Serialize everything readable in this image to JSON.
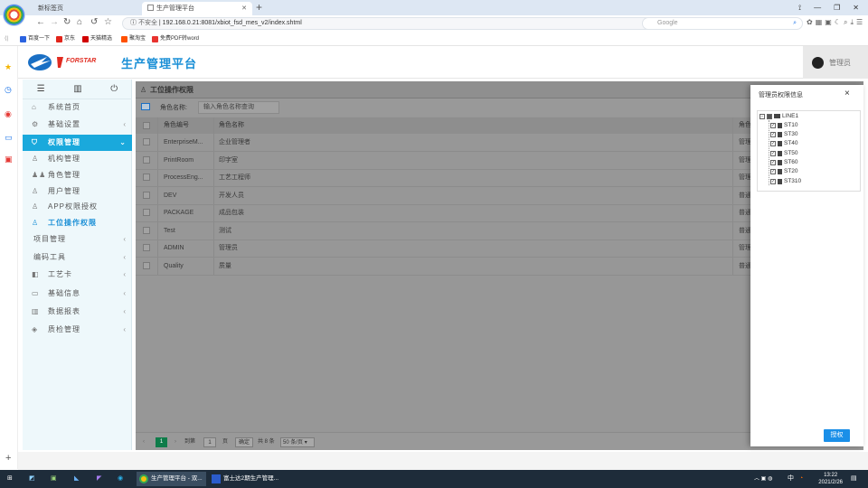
{
  "browser": {
    "tabs": [
      {
        "label": "新标签页"
      },
      {
        "label": "生产管理平台"
      }
    ],
    "new_tab": "+",
    "window_controls": [
      "⟟",
      "—",
      "❐",
      "✕"
    ],
    "insecure": "不安全",
    "url": "192.168.0.21:8081/xbiot_fsd_mes_v2/index.shtml",
    "search_engine": "Google",
    "bookmarks": [
      {
        "label": "百度一下",
        "color": "#2b63e0"
      },
      {
        "label": "京东",
        "color": "#e1251b"
      },
      {
        "label": "天猫精选",
        "color": "#d10000"
      },
      {
        "label": "聚淘宝",
        "color": "#ff5000"
      },
      {
        "label": "免费PDF转word",
        "color": "#e8332f"
      }
    ]
  },
  "app": {
    "logo_text": "FORSTAR",
    "title": "生产管理平台",
    "user": "管理员"
  },
  "sidebar": {
    "items": [
      {
        "label": "系统首页",
        "icon": "home-icon",
        "chevron": ""
      },
      {
        "label": "基础设置",
        "icon": "gear-icon",
        "chevron": "‹"
      },
      {
        "label": "权限管理",
        "icon": "shield-icon",
        "chevron": "⌄"
      },
      {
        "label": "机构管理",
        "icon": "org-icon",
        "chevron": ""
      },
      {
        "label": "角色管理",
        "icon": "users-icon",
        "chevron": ""
      },
      {
        "label": "用户管理",
        "icon": "user-icon",
        "chevron": ""
      },
      {
        "label": "APP权限授权",
        "icon": "user-icon",
        "chevron": ""
      },
      {
        "label": "工位操作权限",
        "icon": "user-icon",
        "chevron": ""
      },
      {
        "label": "项目管理",
        "icon": "",
        "chevron": "‹"
      },
      {
        "label": "编码工具",
        "icon": "",
        "chevron": "‹"
      },
      {
        "label": "工艺卡",
        "icon": "card-icon",
        "chevron": "‹"
      },
      {
        "label": "基础信息",
        "icon": "monitor-icon",
        "chevron": "‹"
      },
      {
        "label": "数据报表",
        "icon": "report-icon",
        "chevron": "‹"
      },
      {
        "label": "质检管理",
        "icon": "quality-icon",
        "chevron": "‹"
      }
    ]
  },
  "panel": {
    "title": "工位操作权限",
    "search_label": "角色名称:",
    "search_placeholder": "输入角色名称查询"
  },
  "table": {
    "headers": [
      "角色编号",
      "角色名称",
      "角色属"
    ],
    "rows": [
      [
        "EnterpriseM...",
        "企业管理者",
        "管理"
      ],
      [
        "PrintRoom",
        "印字室",
        "管理"
      ],
      [
        "ProcessEng...",
        "工艺工程师",
        "管理"
      ],
      [
        "DEV",
        "开发人员",
        "普通用"
      ],
      [
        "PACKAGE",
        "成品包装",
        "普通用"
      ],
      [
        "Test",
        "测试",
        "普通用"
      ],
      [
        "ADMIN",
        "管理员",
        "管理"
      ],
      [
        "Quality",
        "质量",
        "普通用"
      ]
    ]
  },
  "pager": {
    "current": "1",
    "goto": "到第",
    "page_input": "1",
    "page_unit": "页",
    "confirm": "确定",
    "total": "共 8 条",
    "page_size": "50 条/页"
  },
  "modal": {
    "title": "管理员权限信息",
    "close": "×",
    "root": "LINE1",
    "nodes": [
      "ST10",
      "ST30",
      "ST40",
      "ST50",
      "ST60",
      "ST20",
      "ST310"
    ],
    "button": "授权"
  },
  "taskbar": {
    "windows": [
      "生产管理平台 - 双...",
      "富士达2期生产管理..."
    ],
    "time": "13:22",
    "date": "2021/2/26",
    "ime": "中"
  }
}
